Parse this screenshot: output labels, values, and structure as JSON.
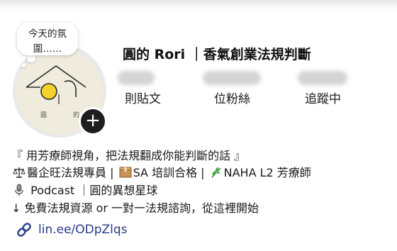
{
  "note": {
    "text_line1": "今天的氛",
    "text_line2": "圍……"
  },
  "avatar": {
    "caption_left": "圓",
    "caption_right": "的"
  },
  "profile": {
    "name": "圓的 Rori ｜香氣創業法規判斷"
  },
  "stats": [
    {
      "label": "則貼文"
    },
    {
      "label": "位粉絲"
    },
    {
      "label": "追蹤中"
    }
  ],
  "bio": {
    "line1": "『 用芳療師視角，把法規翻成你能判斷的話 』",
    "line2_part1": "醫企旺法規專員 |",
    "line2_part2": "SA 培訓合格 |",
    "line2_part3": "NAHA L2 芳療師",
    "line3": "Podcast ｜圓的異想星球",
    "line4": "↓ 免費法規資源 or 一對一法規諮詢，從這裡開始"
  },
  "link": {
    "text": "lin.ee/ODpZlqs"
  },
  "colors": {
    "link": "#283a8c",
    "badge": "#1e1e1e",
    "accent_yellow": "#f4d22a"
  },
  "icons": [
    "plus-icon",
    "scales-icon",
    "package-icon",
    "herb-icon",
    "microphone-icon",
    "link-icon"
  ]
}
